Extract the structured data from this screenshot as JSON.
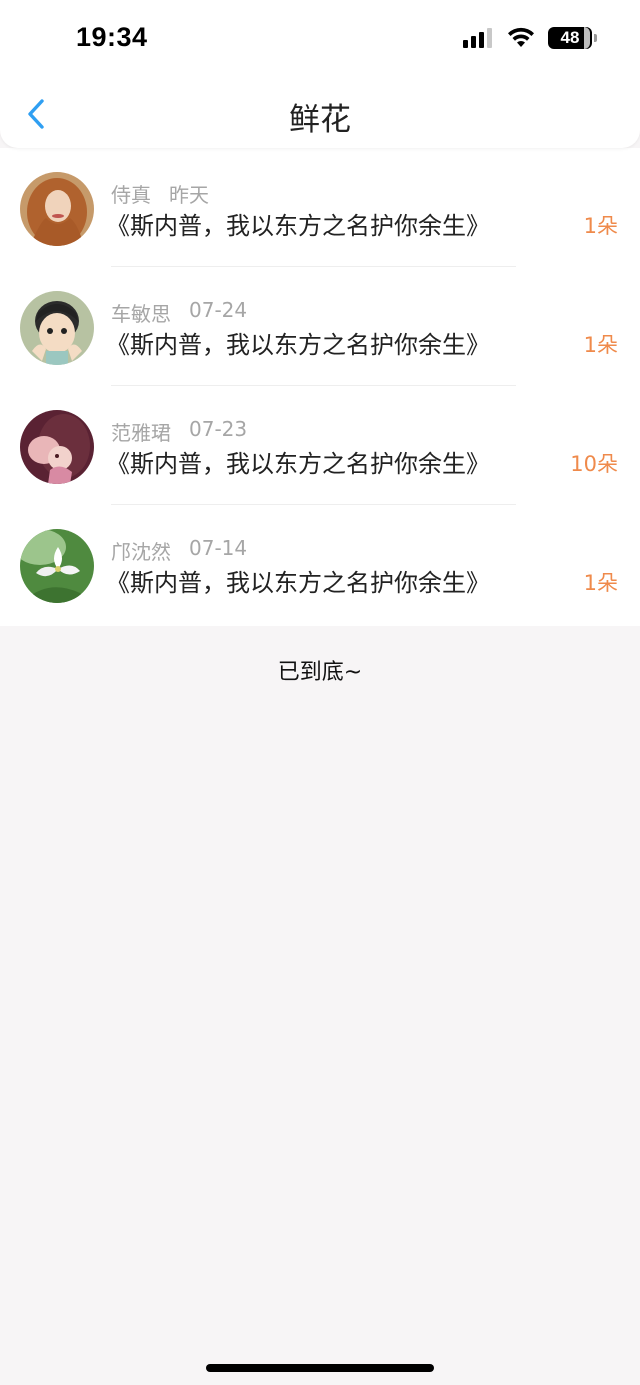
{
  "status_bar": {
    "time": "19:34",
    "battery": "48"
  },
  "nav": {
    "title": "鲜花"
  },
  "list": [
    {
      "name": "侍真",
      "date": "昨天",
      "message": "《斯内普，我以东方之名护你余生》",
      "count": "1朵",
      "avatar_icon": "woman-portrait-avatar"
    },
    {
      "name": "车敏思",
      "date": "07-24",
      "message": "《斯内普，我以东方之名护你余生》",
      "count": "1朵",
      "avatar_icon": "anime-child-avatar"
    },
    {
      "name": "范雅珺",
      "date": "07-23",
      "message": "《斯内普，我以东方之名护你余生》",
      "count": "10朵",
      "avatar_icon": "anime-girl-avatar"
    },
    {
      "name": "邝沈然",
      "date": "07-14",
      "message": "《斯内普，我以东方之名护你余生》",
      "count": "1朵",
      "avatar_icon": "white-flower-avatar"
    }
  ],
  "footer": {
    "end_text": "已到底~"
  },
  "colors": {
    "accent_back": "#2f9ff2",
    "count_orange": "#ef8a4b"
  }
}
